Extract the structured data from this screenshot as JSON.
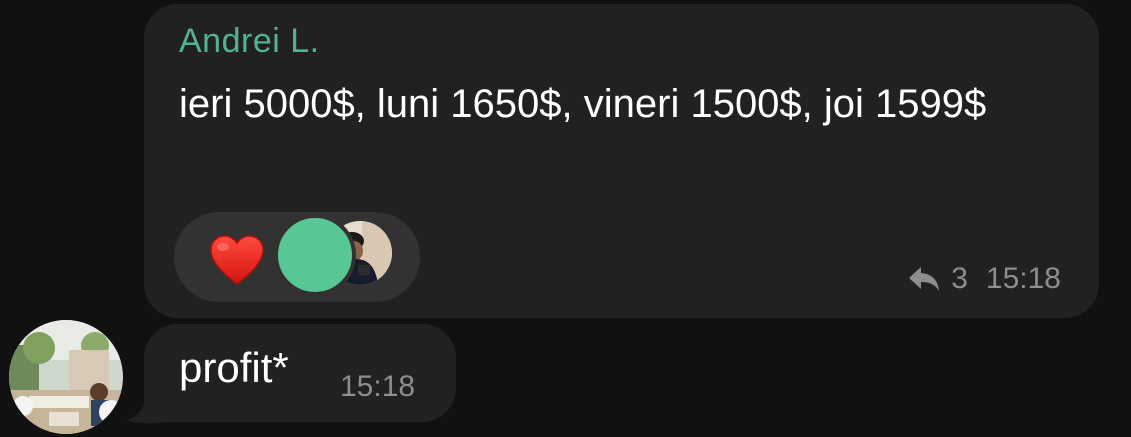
{
  "message1": {
    "sender": "Andrei L.",
    "text": "ieri 5000$, luni 1650$, vineri 1500$, joi 1599$",
    "reply_count": "3",
    "time": "15:18",
    "reactions": [
      "heart"
    ]
  },
  "message2": {
    "text": "profit*",
    "time": "15:18"
  },
  "colors": {
    "background": "#111111",
    "bubble": "#212121",
    "sender_name": "#52b392",
    "reaction_pill": "#323232",
    "avatar_green": "#57c793",
    "heart": "#e3231e",
    "meta_text": "#8d8d8d"
  },
  "icons": {
    "reaction": "heart-icon",
    "reply": "reply-arrow-icon"
  }
}
